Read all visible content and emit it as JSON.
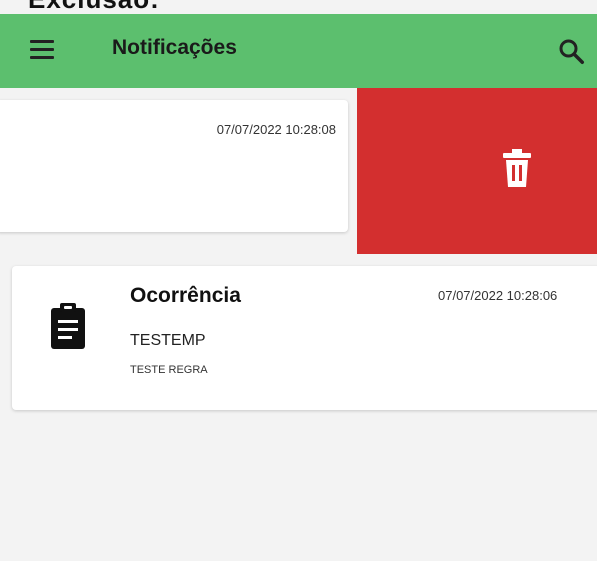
{
  "caption": "Exclusão:",
  "appbar": {
    "title": "Notificações",
    "menu_icon": "menu-icon",
    "search_icon": "search-icon",
    "color": "#5cbf6e"
  },
  "swiped_item": {
    "date": "07/07/2022 10:28:08",
    "delete_color": "#d32f2f",
    "delete_icon": "trash-icon"
  },
  "notification": {
    "icon": "clipboard-icon",
    "title": "Ocorrência",
    "date": "07/07/2022 10:28:06",
    "subtitle": "TESTEMP",
    "detail": "TESTE REGRA"
  }
}
